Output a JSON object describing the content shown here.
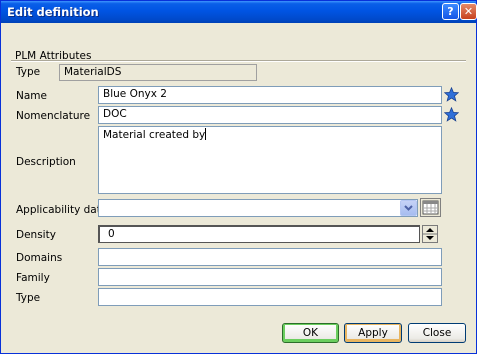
{
  "window": {
    "title": "Edit definition",
    "help_label": "?",
    "close_label": "✕"
  },
  "group": {
    "label": "PLM Attributes"
  },
  "fields": {
    "type": {
      "label": "Type",
      "value": "MaterialDS"
    },
    "name": {
      "label": "Name",
      "value": "Blue Onyx 2"
    },
    "nomenclature": {
      "label": "Nomenclature",
      "value": "DOC"
    },
    "description": {
      "label": "Description",
      "value": "Material created by"
    },
    "applicability_date": {
      "label": "Applicability date",
      "value": ""
    },
    "density": {
      "label": "Density",
      "value": "0"
    },
    "domains": {
      "label": "Domains",
      "value": ""
    },
    "family": {
      "label": "Family",
      "value": ""
    },
    "type2": {
      "label": "Type",
      "value": ""
    }
  },
  "buttons": {
    "ok": "OK",
    "apply": "Apply",
    "close": "Close"
  },
  "colors": {
    "titlebar": "#0054e3",
    "dialog_bg": "#ece9d8",
    "star": "#2f6fd8",
    "field_border": "#7f9db9"
  },
  "icons": {
    "name_star": "star-icon",
    "nomenclature_star": "star-icon",
    "dropdown": "chevron-down-icon",
    "calendar": "calendar-icon",
    "spinner": "spinner-icon"
  }
}
